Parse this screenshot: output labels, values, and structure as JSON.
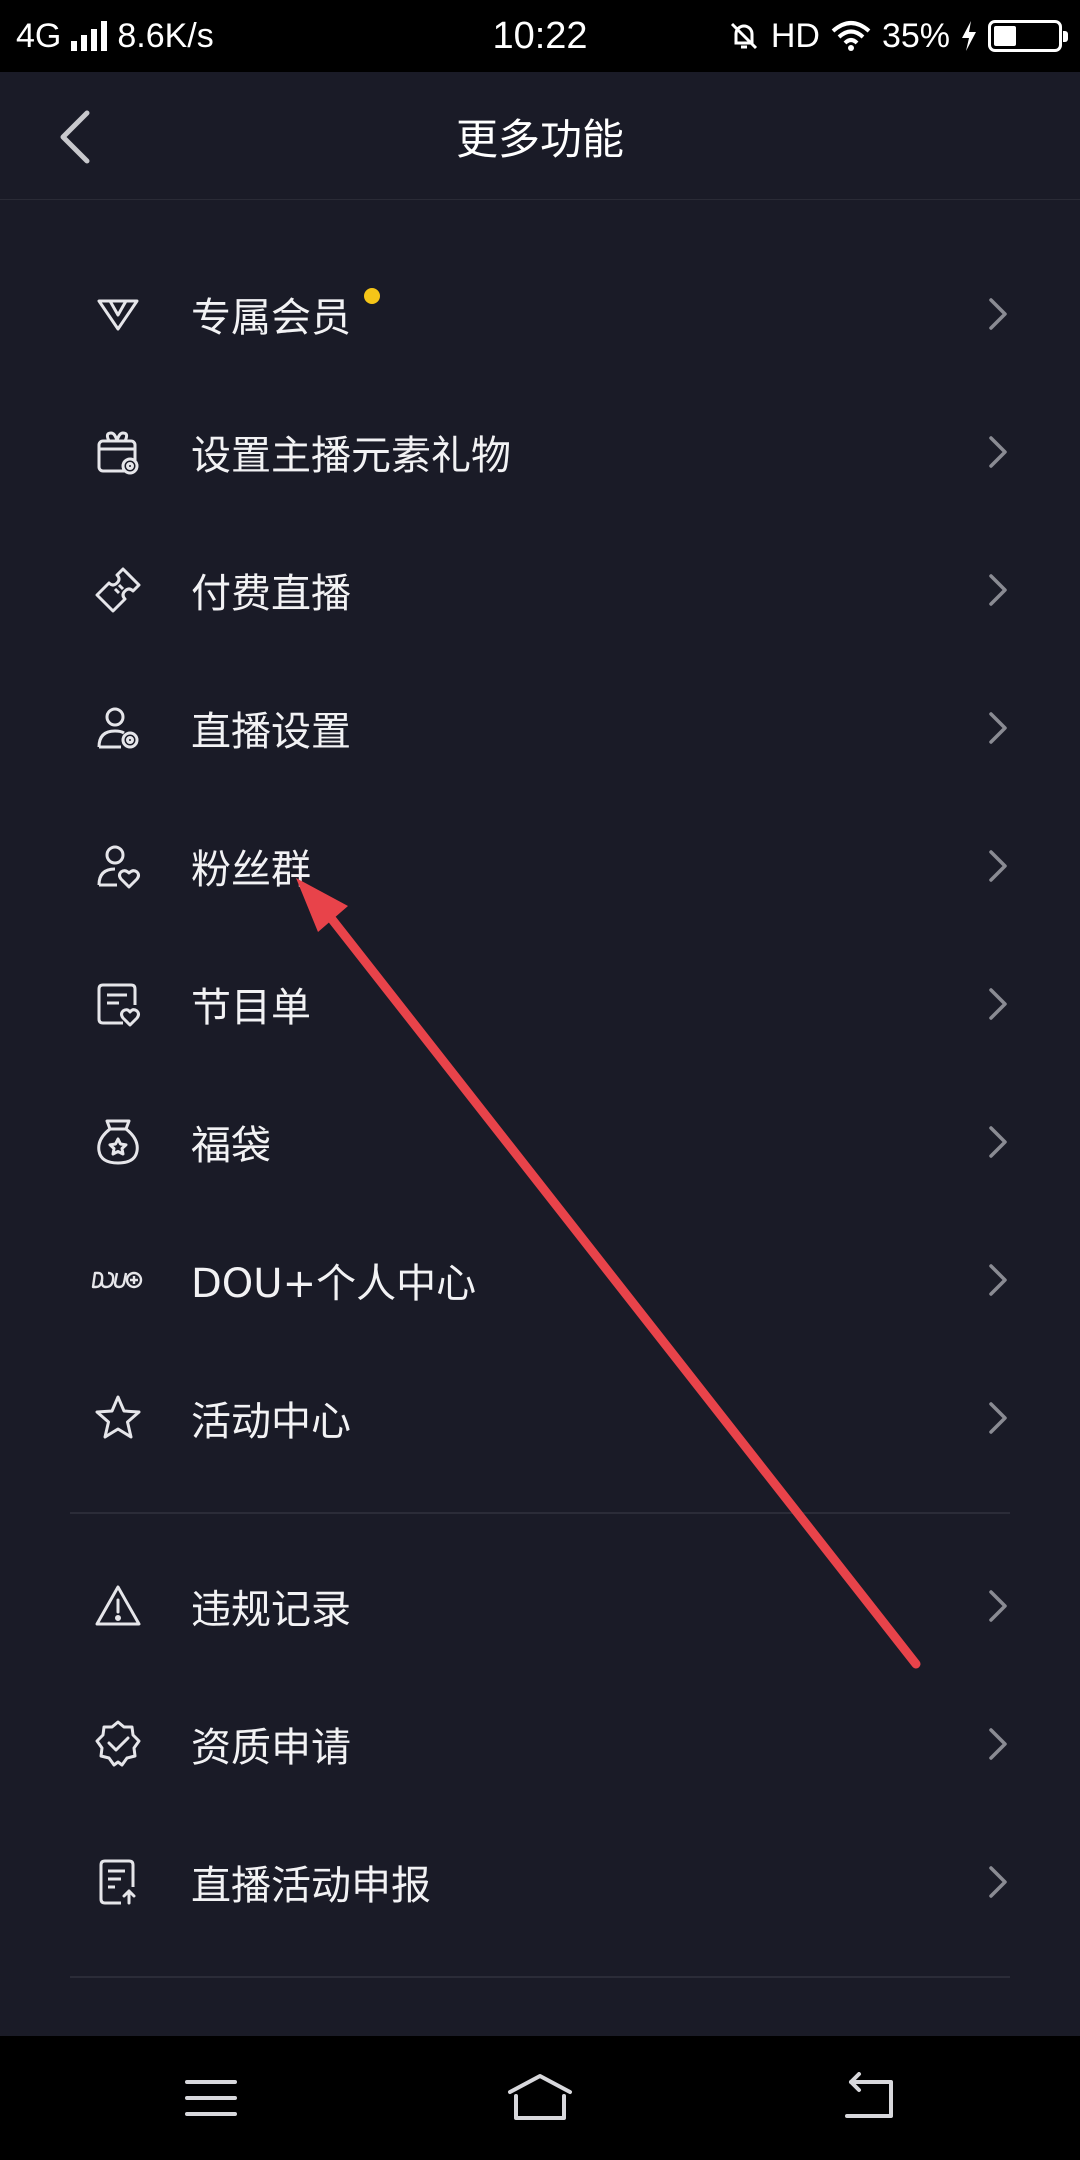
{
  "status_bar": {
    "network": "4G",
    "speed": "8.6K/s",
    "time": "10:22",
    "hd": "HD",
    "battery_percent": "35%",
    "battery_level": 0.35
  },
  "header": {
    "title": "更多功能",
    "back_icon": "chevron-left-icon"
  },
  "menu": {
    "group1": [
      {
        "label": "专属会员",
        "icon": "v-badge-icon",
        "badge": true
      },
      {
        "label": "设置主播元素礼物",
        "icon": "gift-settings-icon"
      },
      {
        "label": "付费直播",
        "icon": "ticket-icon"
      },
      {
        "label": "直播设置",
        "icon": "user-settings-icon"
      },
      {
        "label": "粉丝群",
        "icon": "fan-group-icon"
      },
      {
        "label": "节目单",
        "icon": "program-list-icon"
      },
      {
        "label": "福袋",
        "icon": "lucky-bag-icon"
      },
      {
        "label": "DOU+个人中心",
        "icon": "dou-plus-icon"
      },
      {
        "label": "活动中心",
        "icon": "star-icon"
      }
    ],
    "group2": [
      {
        "label": "违规记录",
        "icon": "warning-icon"
      },
      {
        "label": "资质申请",
        "icon": "verified-badge-icon"
      },
      {
        "label": "直播活动申报",
        "icon": "document-upload-icon"
      }
    ]
  },
  "nav_bar": {
    "menu_icon": "menu-lines-icon",
    "home_icon": "home-icon",
    "back_icon": "back-arrow-icon"
  },
  "colors": {
    "background": "#1a1b27",
    "badge": "#f5c518",
    "annotation_arrow": "#e8434a"
  }
}
